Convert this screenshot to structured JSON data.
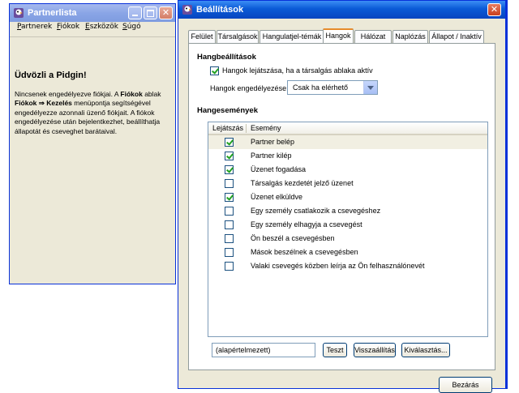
{
  "buddy_window": {
    "title": "Partnerlista",
    "menu": [
      {
        "mnemonic": "P",
        "rest": "artnerek"
      },
      {
        "mnemonic": "F",
        "rest": "iókok"
      },
      {
        "mnemonic": "E",
        "rest": "szközök"
      },
      {
        "mnemonic": "S",
        "rest": "úgó"
      }
    ],
    "welcome_title": "Üdvözli a Pidgin!",
    "welcome_p1": "Nincsenek engedélyezve fiókjai. A ",
    "welcome_b1": "Fiókok",
    "welcome_p2": " ablak ",
    "welcome_b2": "Fiókok ⇒ Kezelés",
    "welcome_p3": " menüpontja segítségével engedélyezze azonnali üzenő fiókjait. A fiókok engedélyezése után bejelentkezhet, beállíthatja állapotát és cseveghet barátaival."
  },
  "prefs_window": {
    "title": "Beállítások",
    "tabs": [
      "Felület",
      "Társalgások",
      "Hangulatjel-témák",
      "Hangok",
      "Hálózat",
      "Naplózás",
      "Állapot / Inaktív"
    ],
    "active_tab": "Hangok",
    "sound_settings_title": "Hangbeállítások",
    "play_when_focused_label": "Hangok lejátszása, ha a társalgás ablaka aktív",
    "play_when_focused_checked": true,
    "enable_sounds_label": "Hangok engedélyezése:",
    "enable_sounds_value": "Csak ha elérhető",
    "sound_events_title": "Hangesemények",
    "columns": [
      "Lejátszás",
      "Esemény"
    ],
    "events": [
      {
        "label": "Partner belép",
        "checked": true
      },
      {
        "label": "Partner kilép",
        "checked": true
      },
      {
        "label": "Üzenet fogadása",
        "checked": true
      },
      {
        "label": "Társalgás kezdetét jelző üzenet",
        "checked": false
      },
      {
        "label": "Üzenet elküldve",
        "checked": true
      },
      {
        "label": "Egy személy csatlakozik a csevegéshez",
        "checked": false
      },
      {
        "label": "Egy személy elhagyja a csevegést",
        "checked": false
      },
      {
        "label": "Ön beszél a csevegésben",
        "checked": false
      },
      {
        "label": "Mások beszélnek a csevegésben",
        "checked": false
      },
      {
        "label": "Valaki csevegés közben leírja az Ön felhasználónevét",
        "checked": false
      }
    ],
    "file_field_value": "(alapértelmezett)",
    "test_button": "Teszt",
    "reset_button": "Visszaállítás",
    "choose_button": "Kiválasztás...",
    "close_button": "Bezárás"
  }
}
